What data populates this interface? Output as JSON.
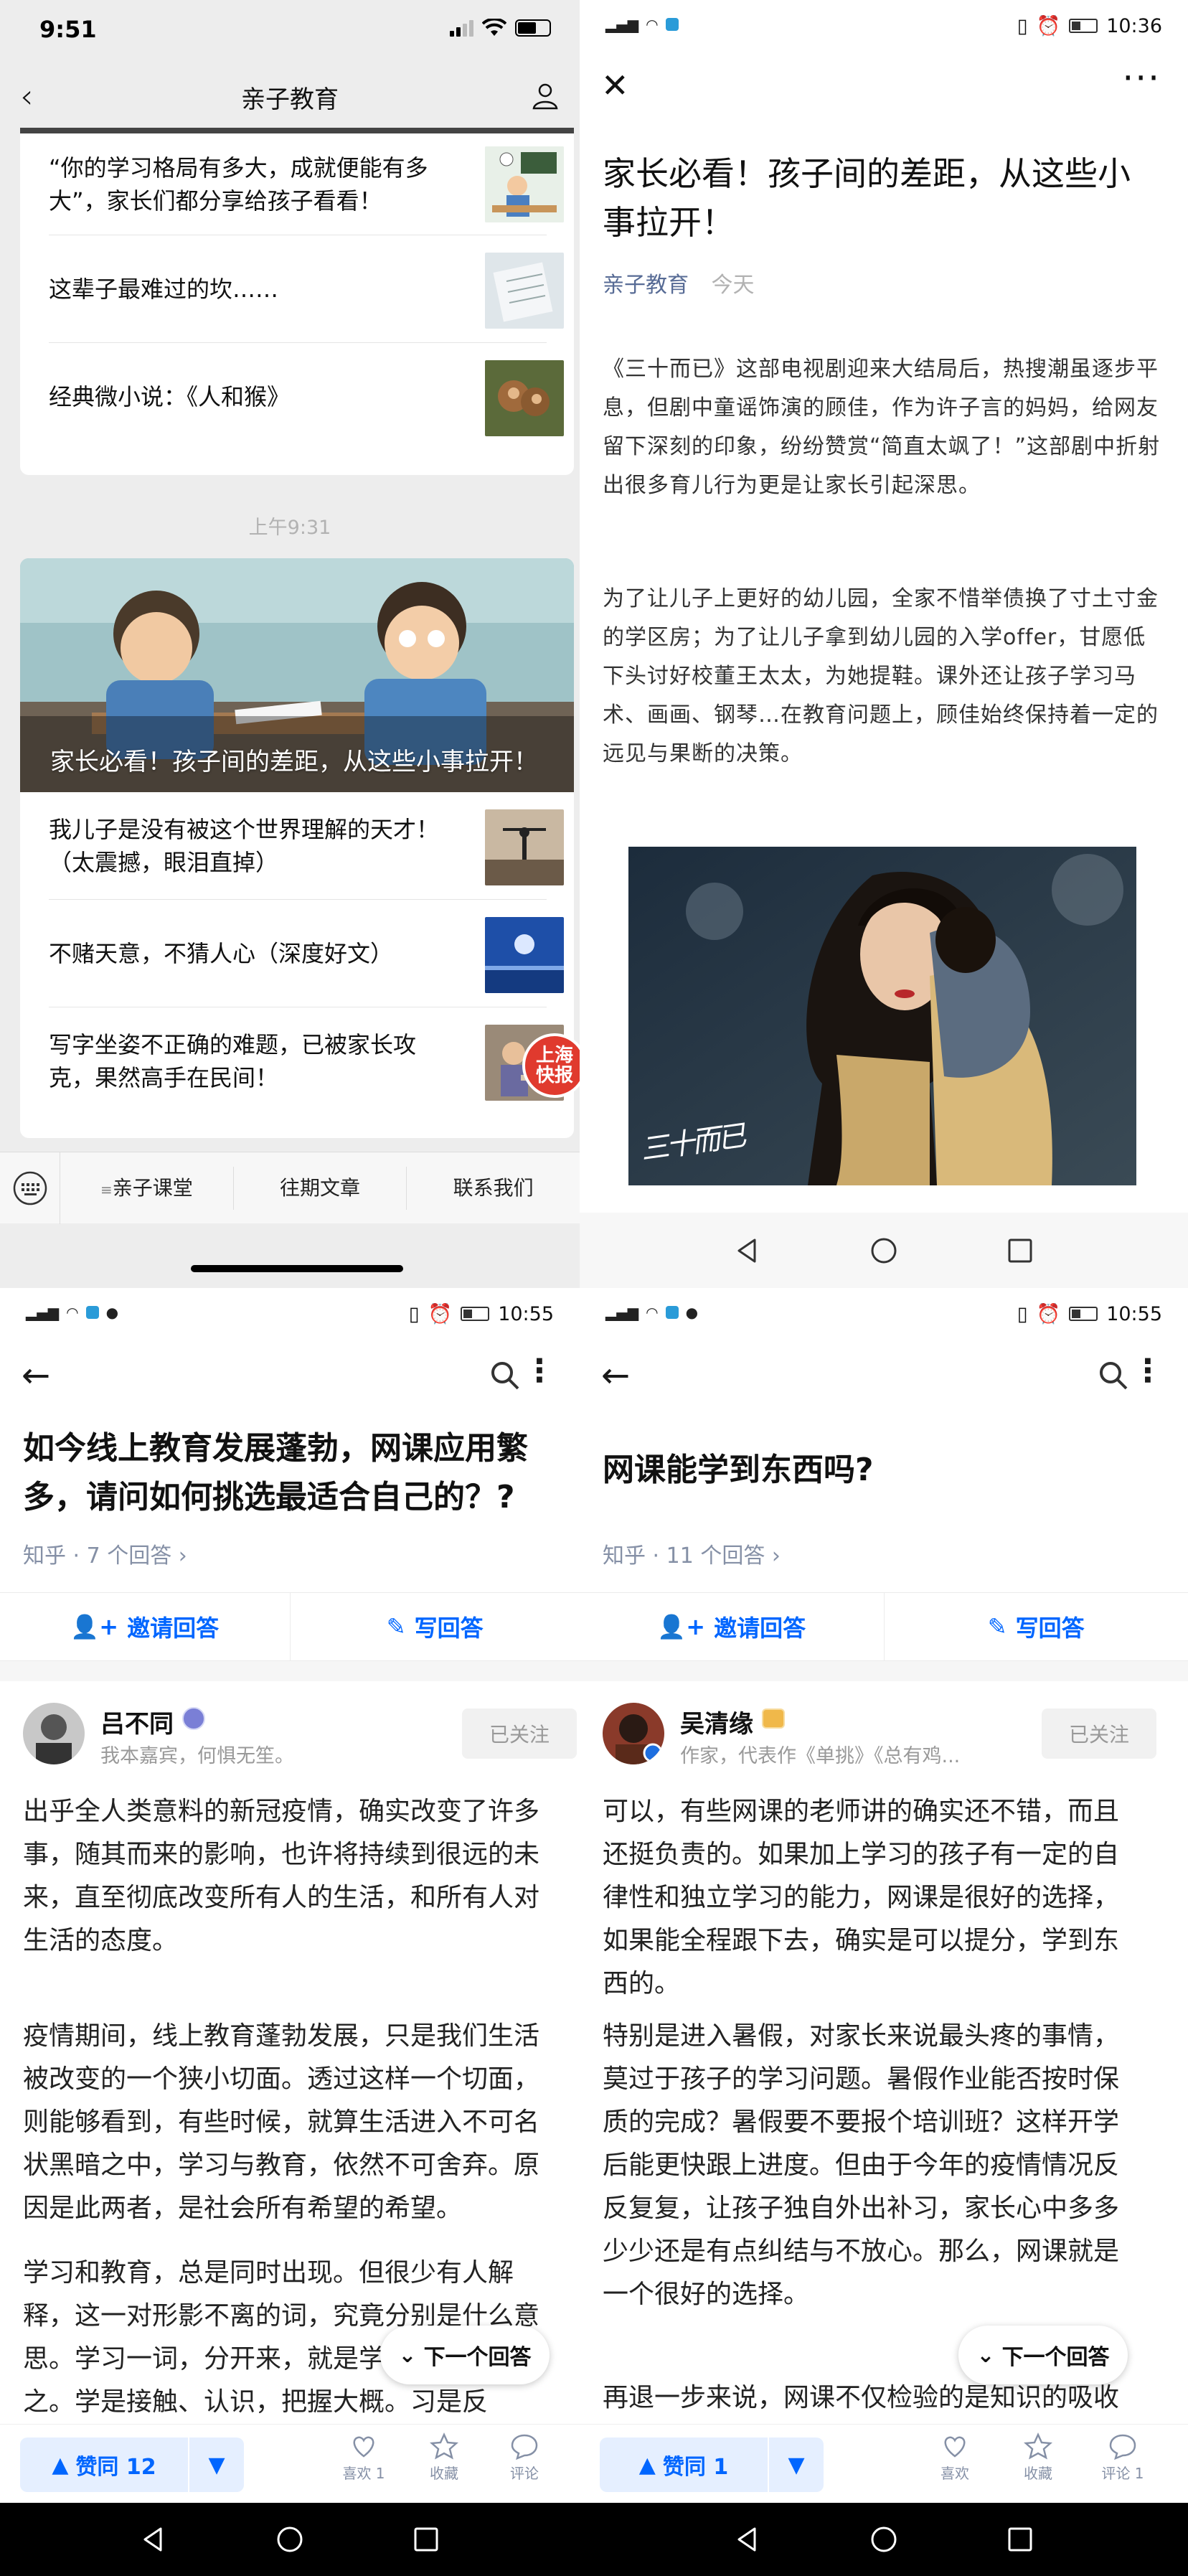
{
  "wechat": {
    "status_time": "9:51",
    "nav_title": "亲子教育",
    "card1_items": [
      {
        "title": "“你的学习格局有多大，成就便能有多大”，家长们都分享给孩子看看！"
      },
      {
        "title": "这辈子最难过的坎……"
      },
      {
        "title": "经典微小说：《人和猴》"
      }
    ],
    "timestamp": "上午9:31",
    "hero_caption": "家长必看！孩子间的差距，从这些小事拉开！",
    "card2_items": [
      {
        "title": "我儿子是没有被这个世界理解的天才！（太震撼，眼泪直掉）"
      },
      {
        "title": "不赌天意，不猜人心（深度好文）"
      },
      {
        "title": "写字坐姿不正确的难题，已被家长攻克，果然高手在民间！"
      }
    ],
    "float_badge": "上海\n快报",
    "menu": [
      "亲子课堂",
      "往期文章",
      "联系我们"
    ]
  },
  "article": {
    "status_time": "10:36",
    "title": "家长必看！孩子间的差距，从这些小事拉开！",
    "source": "亲子教育",
    "date": "今天",
    "para1": "《三十而已》这部电视剧迎来大结局后，热搜潮虽逐步平息，但剧中童谣饰演的顾佳，作为许子言的妈妈，给网友留下深刻的印象，纷纷赞赏“简直太飒了！”这部剧中折射出很多育儿行为更是让家长引起深思。",
    "para2": "为了让儿子上更好的幼儿园，全家不惜举债换了寸土寸金的学区房；为了让儿子拿到幼儿园的入学offer，甘愿低下头讨好校董王太太，为她提鞋。课外还让孩子学习马术、画画、钢琴…在教育问题上，顾佳始终保持着一定的远见与果断的决策。",
    "image_text": "三十而已"
  },
  "zhihu1": {
    "status_time": "10:55",
    "question": "如今线上教育发展蓬勃，网课应用繁多，请问如何挑选最适合自己的？?",
    "meta": "知乎 · 7 个回答 ›",
    "invite": "邀请回答",
    "write": "写回答",
    "author_name": "吕不同",
    "author_bio": "我本嘉宾，何惧无笙。",
    "follow": "已关注",
    "p1": "出乎全人类意料的新冠疫情，确实改变了许多事，随其而来的影响，也许将持续到很远的未来，直至彻底改变所有人的生活，和所有人对生活的态度。",
    "p2": "疫情期间，线上教育蓬勃发展，只是我们生活被改变的一个狭小切面。透过这样一个切面，则能够看到，有些时候，就算生活进入不可名状黑暗之中，学习与教育，依然不可舍弃。原因是此两者，是社会所有希望的希望。",
    "p3": "学习和教育，总是同时出现。但很少有人解释，这一对形影不离的词，究竟分别是什么意思。学习一词，分开来，就是学之……时习之。学是接触、认识，把握大概。习是反",
    "next": "下一个回答",
    "vote": "赞同 12",
    "like": "喜欢 1",
    "collect": "收藏",
    "comment": "评论"
  },
  "zhihu2": {
    "status_time": "10:55",
    "question": "网课能学到东西吗?",
    "meta": "知乎 · 11 个回答 ›",
    "invite": "邀请回答",
    "write": "写回答",
    "author_name": "吴清缘",
    "author_bio": "作家，代表作《单挑》《总有鸡...",
    "follow": "已关注",
    "p1": "可以，有些网课的老师讲的确实还不错，而且还挺负责的。如果加上学习的孩子有一定的自律性和独立学习的能力，网课是很好的选择，如果能全程跟下去，确实是可以提分，学到东西的。",
    "p2": "特别是进入暑假，对家长来说最头疼的事情，莫过于孩子的学习问题。暑假作业能否按时保质的完成？暑假要不要报个培训班？这样开学后能更快跟上进度。但由于今年的疫情情况反反复复，让孩子独自外出补习，家长心中多多少少还是有点纠结与不放心。那么，网课就是一个很好的选择。",
    "p3": "再退一步来说，网课不仅检验的是知识的吸收",
    "next": "下一个回答",
    "vote": "赞同 1",
    "like": "喜欢",
    "collect": "收藏",
    "comment": "评论 1"
  },
  "colors": {
    "wechat_link": "#576b95",
    "zhihu_blue": "#0066ff",
    "zhihu_meta": "#8590a6"
  }
}
